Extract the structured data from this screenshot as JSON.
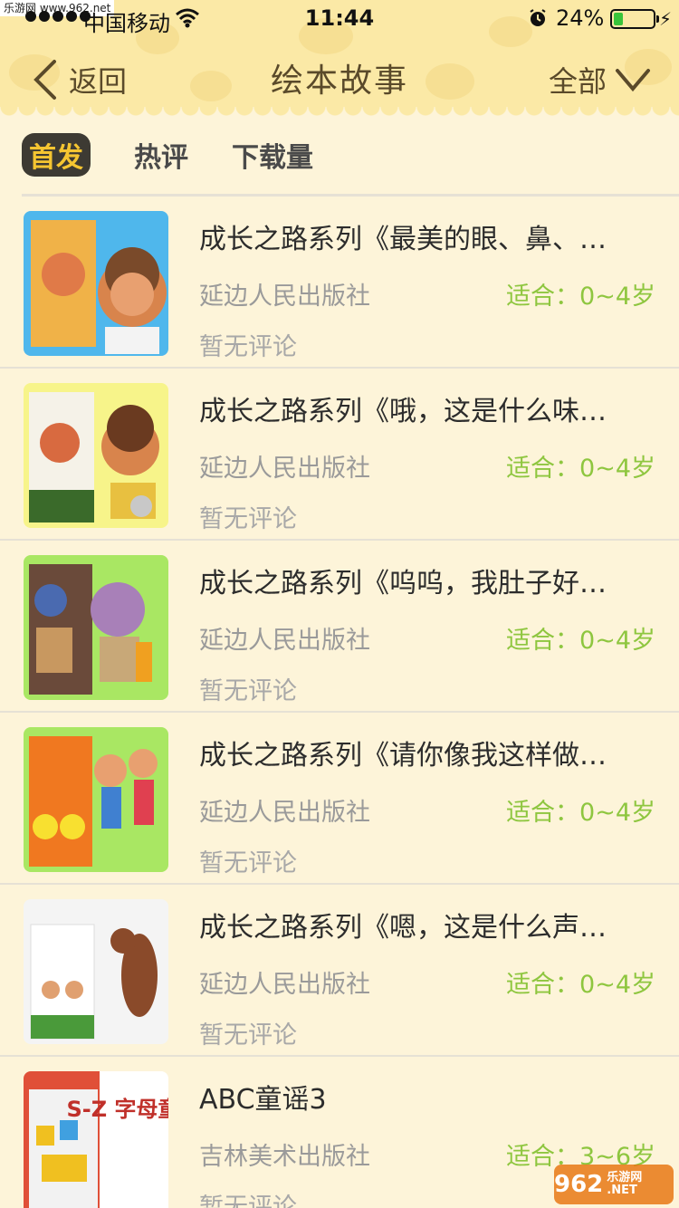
{
  "status_bar": {
    "watermark": "乐游网 www.962.net",
    "carrier": "中国移动",
    "time": "11:44",
    "battery_percent": "24%",
    "battery_level": 0.24
  },
  "nav": {
    "back_label": "返回",
    "title": "绘本故事",
    "filter_label": "全部"
  },
  "tabs": [
    {
      "label": "首发",
      "active": true
    },
    {
      "label": "热评",
      "active": false
    },
    {
      "label": "下载量",
      "active": false
    }
  ],
  "books": [
    {
      "title": "成长之路系列《最美的眼、鼻、…",
      "publisher": "延边人民出版社",
      "age": "适合：0~4岁",
      "comments": "暂无评论",
      "cover_bg": "#4fb7ec"
    },
    {
      "title": "成长之路系列《哦，这是什么味…",
      "publisher": "延边人民出版社",
      "age": "适合：0~4岁",
      "comments": "暂无评论",
      "cover_bg": "#f7f48a"
    },
    {
      "title": "成长之路系列《呜呜，我肚子好…",
      "publisher": "延边人民出版社",
      "age": "适合：0~4岁",
      "comments": "暂无评论",
      "cover_bg": "#a9e763"
    },
    {
      "title": "成长之路系列《请你像我这样做…",
      "publisher": "延边人民出版社",
      "age": "适合：0~4岁",
      "comments": "暂无评论",
      "cover_bg": "#a9e763"
    },
    {
      "title": "成长之路系列《嗯，这是什么声…",
      "publisher": "延边人民出版社",
      "age": "适合：0~4岁",
      "comments": "暂无评论",
      "cover_bg": "#f4f4f4"
    },
    {
      "title": "ABC童谣3",
      "publisher": "吉林美术出版社",
      "age": "适合：3~6岁",
      "comments": "暂无评论",
      "cover_bg": "#ffffff",
      "cover_text": "S-Z 字母童谣"
    }
  ],
  "watermark_br": {
    "brand": "962",
    "sub": "乐游网 .NET"
  },
  "colors": {
    "header_bg": "#fbe9a6",
    "page_bg": "#fdf4d9",
    "age_green": "#8ec63f",
    "tab_active_bg": "#3d3a33",
    "tab_active_text": "#f5c531"
  }
}
